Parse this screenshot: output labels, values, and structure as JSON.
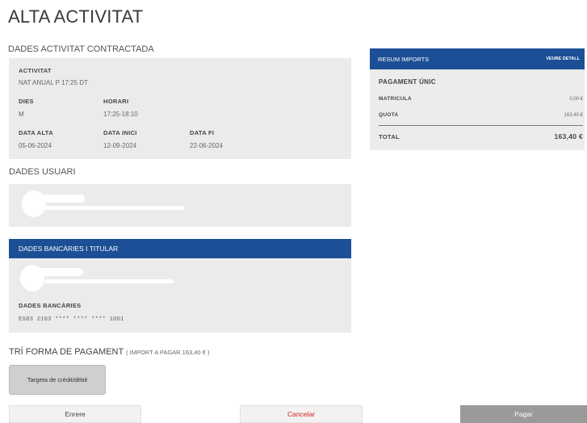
{
  "page": {
    "title": "ALTA ACTIVITAT"
  },
  "activity": {
    "section_title": "DADES ACTIVITAT CONTRACTADA",
    "activity_label": "ACTIVITAT",
    "activity_value": "NAT ANUAL P 17:25 DT",
    "days_label": "DIES",
    "days_value": "M",
    "schedule_label": "HORARI",
    "schedule_value": "17:25-18:10",
    "date_alta_label": "DATA ALTA",
    "date_alta_value": "05-06-2024",
    "date_start_label": "DATA INICI",
    "date_start_value": "12-09-2024",
    "date_end_label": "DATA FI",
    "date_end_value": "22-06-2024"
  },
  "user": {
    "section_title": "DADES USUARI"
  },
  "bank": {
    "header": "DADES BANCÀRIES I TITULAR",
    "label": "DADES BANCÀRIES",
    "iban": "ES83 2103 **** **** **** 1061"
  },
  "payment": {
    "title": "TRÍ FORMA DE PAGAMENT",
    "import_note": "( IMPORT A PAGAR 163,40 € )",
    "method_button": "Targeta de crèdit/dèbit"
  },
  "summary": {
    "header": "RESUM IMPORTS",
    "detail_link": "VEURE DETALL",
    "single_payment": "PAGAMENT ÚNIC",
    "matricula_label": "MATRICULA",
    "matricula_value": "0,00 €",
    "quota_label": "QUOTA",
    "quota_value": "163,40 €",
    "total_label": "TOTAL",
    "total_value": "163,40 €"
  },
  "actions": {
    "back": "Enrere",
    "cancel": "Cancelar",
    "pay": "Pagar"
  },
  "colors": {
    "accent": "#1c4f96",
    "panel": "#ebebeb",
    "cancel_text": "#d02020",
    "pay_button": "#9a9a9a"
  }
}
